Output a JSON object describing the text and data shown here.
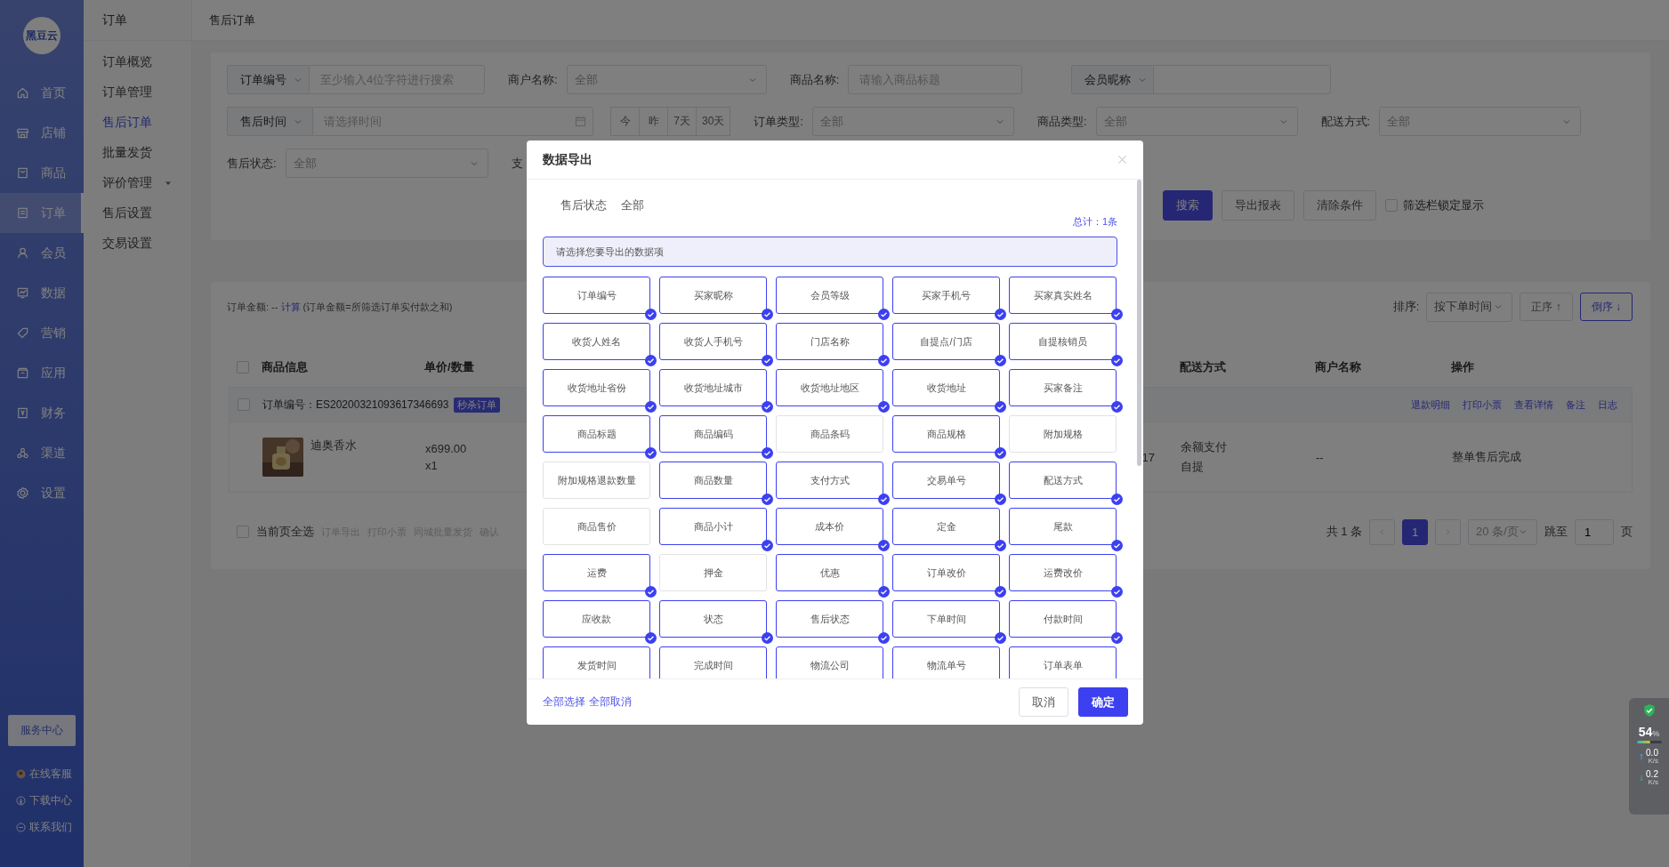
{
  "sidebar": {
    "logo": "黑豆云",
    "items": [
      {
        "label": "首页",
        "selected": false
      },
      {
        "label": "店铺",
        "selected": false
      },
      {
        "label": "商品",
        "selected": false
      },
      {
        "label": "订单",
        "selected": true
      },
      {
        "label": "会员",
        "selected": false
      },
      {
        "label": "数据",
        "selected": false
      },
      {
        "label": "营销",
        "selected": false
      },
      {
        "label": "应用",
        "selected": false
      },
      {
        "label": "财务",
        "selected": false
      },
      {
        "label": "渠道",
        "selected": false
      },
      {
        "label": "设置",
        "selected": false
      }
    ],
    "service_button": "服务中心",
    "links": [
      "在线客服",
      "下载中心",
      "联系我们"
    ]
  },
  "submenu": {
    "title": "订单",
    "items": [
      {
        "label": "订单概览",
        "selected": false,
        "kind": "link"
      },
      {
        "label": "订单管理",
        "selected": false,
        "kind": "link"
      },
      {
        "label": "售后订单",
        "selected": true,
        "kind": "link"
      },
      {
        "label": "批量发货",
        "selected": false,
        "kind": "link"
      },
      {
        "label": "评价管理",
        "selected": false,
        "kind": "group"
      },
      {
        "label": "售后设置",
        "selected": false,
        "kind": "link"
      },
      {
        "label": "交易设置",
        "selected": false,
        "kind": "link"
      }
    ]
  },
  "header": {
    "title": "售后订单"
  },
  "filter_rows": [
    [
      {
        "kind": "prefixed",
        "prefix": "订单编号",
        "placeholder": "至少输入4位字符进行搜索"
      },
      {
        "kind": "select",
        "label": "商户名称:",
        "value": "全部"
      },
      {
        "kind": "input",
        "label": "商品名称:",
        "placeholder": "请输入商品标题"
      },
      {
        "kind": "prefixed",
        "prefix": "会员昵称"
      }
    ],
    [
      {
        "kind": "date",
        "prefix": "售后时间",
        "placeholder": "请选择时间"
      },
      {
        "kind": "quick",
        "options": [
          "今",
          "昨",
          "7天",
          "30天"
        ]
      },
      {
        "kind": "select",
        "label": "订单类型:",
        "value": "全部"
      },
      {
        "kind": "select",
        "label": "商品类型:",
        "value": "全部"
      },
      {
        "kind": "select",
        "label": "配送方式:",
        "value": "全部"
      }
    ],
    [
      {
        "kind": "select",
        "label": "售后状态:",
        "value": "全部"
      },
      {
        "kind": "text",
        "label": "支"
      }
    ]
  ],
  "actions": {
    "buttons": [
      {
        "label": "搜索",
        "kind": "primary"
      },
      {
        "label": "导出报表",
        "kind": "default"
      },
      {
        "label": "清除条件",
        "kind": "default"
      }
    ],
    "lock": {
      "label": "筛选栏锁定显示",
      "checked": false
    }
  },
  "summary": {
    "label": "订单金额:",
    "value": "--",
    "link": "计算",
    "note": "(订单金额=所筛选订单实付款之和)"
  },
  "sort": {
    "label": "排序:",
    "value": "按下单时间",
    "options": [
      {
        "label": "正序",
        "arrow": "↑",
        "selected": false
      },
      {
        "label": "倒序",
        "arrow": "↓",
        "selected": true
      }
    ]
  },
  "table": {
    "select_all_checked": false,
    "columns": [
      "商品信息",
      "单价/数量",
      "配送方式",
      "商户名称",
      "操作"
    ],
    "order": {
      "checked": false,
      "number": "订单编号：ES20200321093617346693",
      "badge": "秒杀订单",
      "actions": [
        "退款明细",
        "打印小票",
        "查看详情",
        "备注",
        "日志"
      ]
    },
    "rows": [
      {
        "kind": "picture",
        "product": "迪奥香水",
        "price": "x699.00",
        "quantity": "x1",
        "column_5": "17",
        "payment": "余额支付",
        "delivery": "自提",
        "merchant": "--",
        "status": "整单售后完成"
      }
    ]
  },
  "footer": {
    "select_all": {
      "label": "当前页全选",
      "checked": false
    },
    "bulk_actions": [
      "订单导出",
      "打印小票",
      "同城批量发货",
      "确认"
    ],
    "pagination": {
      "total": "共 1 条",
      "pages": [
        {
          "label": "1",
          "selected": true
        }
      ],
      "page_size": "20 条/页",
      "jump_label": "跳至",
      "jump_value": "1",
      "suffix": "页"
    }
  },
  "dialog": {
    "title": "数据导出",
    "filter_label": "售后状态",
    "filter_value": "全部",
    "total": "总计：1条",
    "hint": "请选择您要导出的数据项",
    "fields": [
      {
        "label": "订单编号",
        "checked": true
      },
      {
        "label": "买家昵称",
        "checked": true
      },
      {
        "label": "会员等级",
        "checked": true
      },
      {
        "label": "买家手机号",
        "checked": true
      },
      {
        "label": "买家真实姓名",
        "checked": true
      },
      {
        "label": "收货人姓名",
        "checked": true
      },
      {
        "label": "收货人手机号",
        "checked": true
      },
      {
        "label": "门店名称",
        "checked": true
      },
      {
        "label": "自提点/门店",
        "checked": true
      },
      {
        "label": "自提核销员",
        "checked": true
      },
      {
        "label": "收货地址省份",
        "checked": true
      },
      {
        "label": "收货地址城市",
        "checked": true
      },
      {
        "label": "收货地址地区",
        "checked": true
      },
      {
        "label": "收货地址",
        "checked": true
      },
      {
        "label": "买家备注",
        "checked": true
      },
      {
        "label": "商品标题",
        "checked": true
      },
      {
        "label": "商品编码",
        "checked": true
      },
      {
        "label": "商品条码",
        "checked": false
      },
      {
        "label": "商品规格",
        "checked": true
      },
      {
        "label": "附加规格",
        "checked": false
      },
      {
        "label": "附加规格退款数量",
        "checked": false
      },
      {
        "label": "商品数量",
        "checked": true
      },
      {
        "label": "支付方式",
        "checked": true
      },
      {
        "label": "交易单号",
        "checked": true
      },
      {
        "label": "配送方式",
        "checked": true
      },
      {
        "label": "商品售价",
        "checked": false
      },
      {
        "label": "商品小计",
        "checked": true
      },
      {
        "label": "成本价",
        "checked": true
      },
      {
        "label": "定金",
        "checked": true
      },
      {
        "label": "尾款",
        "checked": true
      },
      {
        "label": "运费",
        "checked": true
      },
      {
        "label": "押金",
        "checked": false
      },
      {
        "label": "优惠",
        "checked": true
      },
      {
        "label": "订单改价",
        "checked": true
      },
      {
        "label": "运费改价",
        "checked": true
      },
      {
        "label": "应收款",
        "checked": true
      },
      {
        "label": "状态",
        "checked": true
      },
      {
        "label": "售后状态",
        "checked": true
      },
      {
        "label": "下单时间",
        "checked": true
      },
      {
        "label": "付款时间",
        "checked": true
      },
      {
        "label": "发货时间",
        "checked": true
      },
      {
        "label": "完成时间",
        "checked": true
      },
      {
        "label": "物流公司",
        "checked": true
      },
      {
        "label": "物流单号",
        "checked": true
      },
      {
        "label": "订单表单",
        "checked": true
      }
    ],
    "select_all": "全部选择",
    "deselect_all": "全部取消",
    "buttons": [
      {
        "label": "取消",
        "kind": "default"
      },
      {
        "label": "确定",
        "kind": "primary"
      }
    ]
  },
  "monitor": {
    "percent": "54",
    "unit": "%",
    "level": 0.54,
    "upload": "0.0",
    "upload_unit": "K/s",
    "download": "0.2",
    "download_unit": "K/s"
  }
}
